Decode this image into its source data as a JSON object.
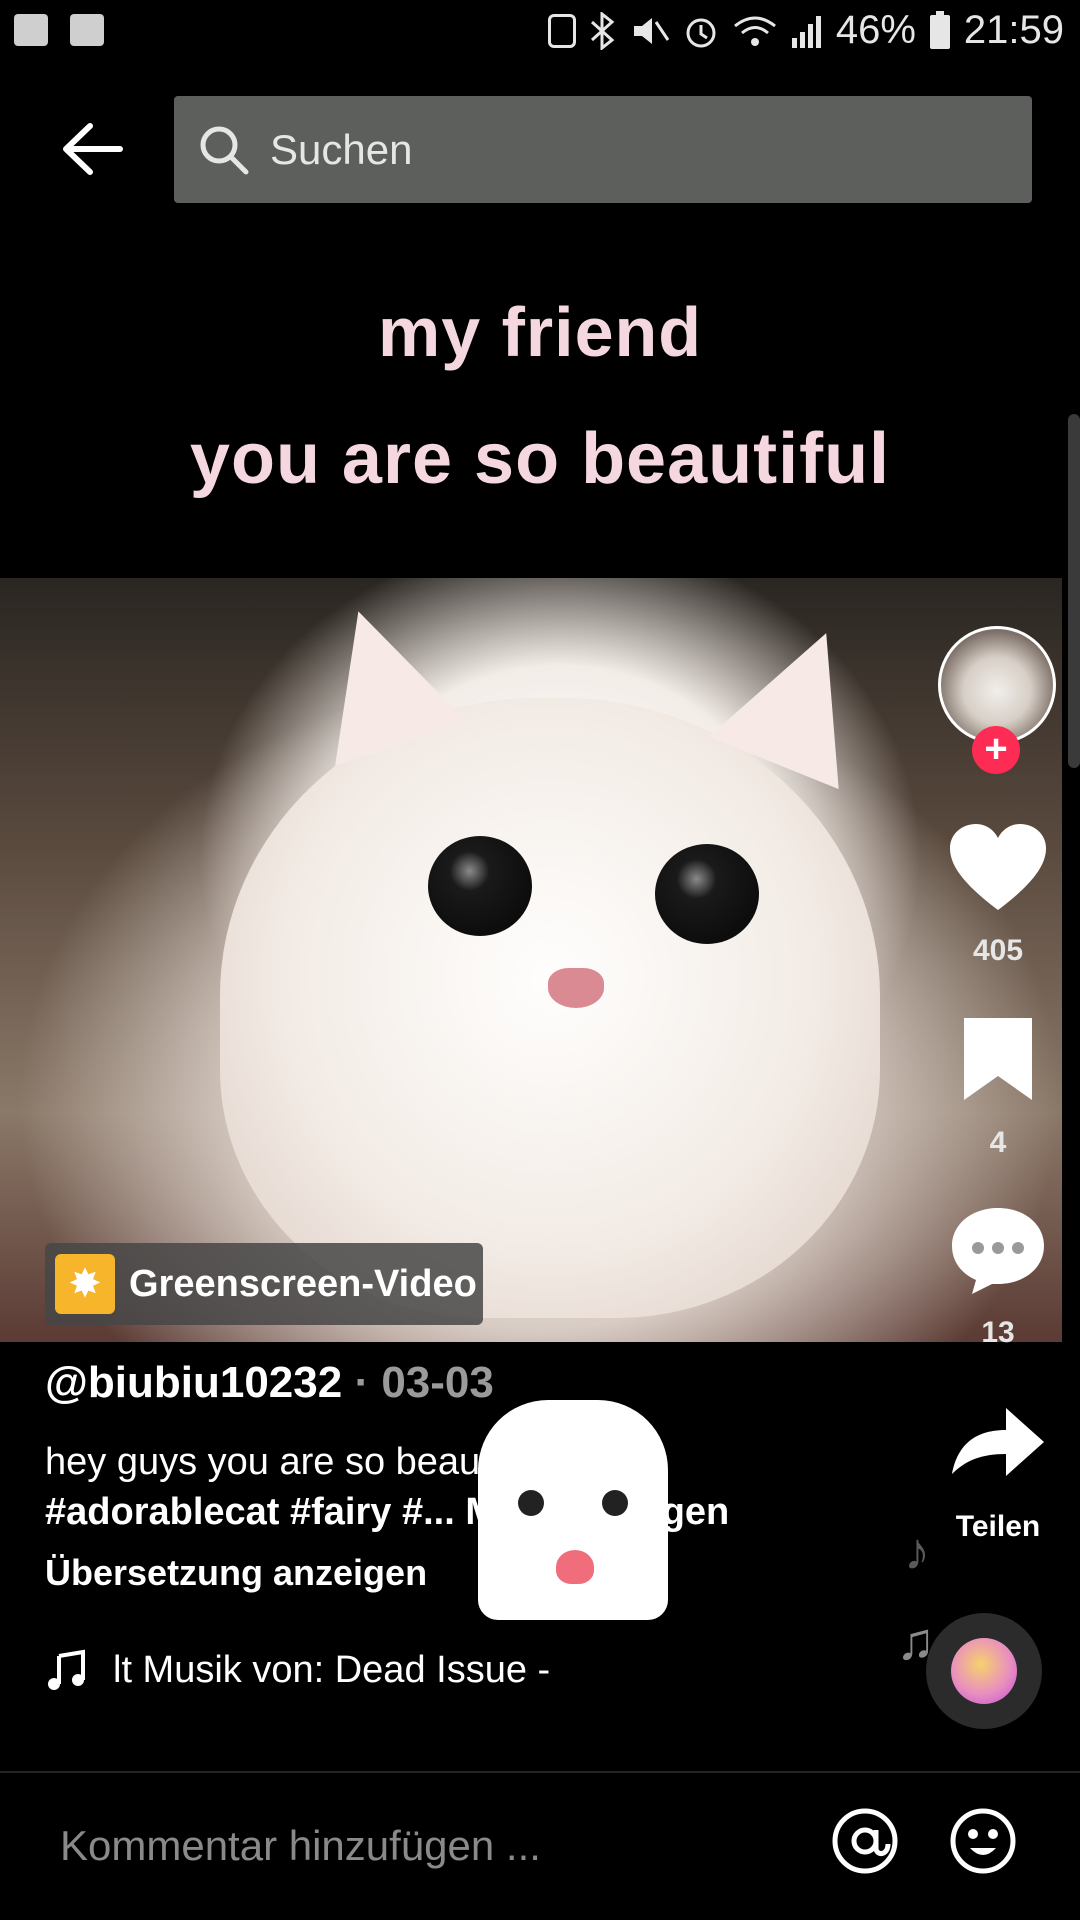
{
  "status_bar": {
    "battery": "46%",
    "time": "21:59"
  },
  "header": {
    "search_placeholder": "Suchen"
  },
  "video": {
    "caption_line1": "my friend",
    "caption_line2": "you are so beautiful",
    "greenscreen_label": "Greenscreen-Video"
  },
  "rail": {
    "likes": "405",
    "saves": "4",
    "comments": "13",
    "share_label": "Teilen"
  },
  "post": {
    "username": "@biubiu10232",
    "date": "· 03-03",
    "description": "hey guys you are so beautiful",
    "tags": "#adorablecat #fairy #...",
    "more_label": "Mehr anzeigen",
    "translate": "Übersetzung anzeigen",
    "music": "lt Musik von: Dead Issue -"
  },
  "comment_bar": {
    "placeholder": "Kommentar hinzufügen ..."
  },
  "colors": {
    "follow_badge": "#fe2c55",
    "greenscreen_icon": "#f6b52a",
    "caption": "#f5d8df"
  }
}
